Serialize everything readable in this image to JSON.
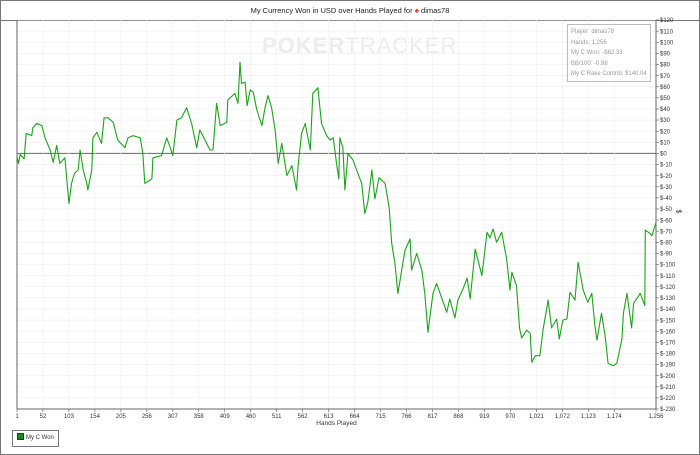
{
  "chart_data": {
    "type": "line",
    "title": "My Currency Won in USD over Hands Played for",
    "player_name": "dimas78",
    "xlabel": "Hands Played",
    "ylabel": "$",
    "xlim": [
      1,
      1256
    ],
    "ylim": [
      -230,
      120
    ],
    "grid": true,
    "x_ticks": [
      "1",
      "52",
      "103",
      "154",
      "205",
      "256",
      "307",
      "358",
      "409",
      "460",
      "511",
      "562",
      "613",
      "664",
      "715",
      "766",
      "817",
      "868",
      "919",
      "970",
      "1,021",
      "1,072",
      "1,123",
      "1,174",
      "1,256"
    ],
    "x_tick_values": [
      1,
      52,
      103,
      154,
      205,
      256,
      307,
      358,
      409,
      460,
      511,
      562,
      613,
      664,
      715,
      766,
      817,
      868,
      919,
      970,
      1021,
      1072,
      1123,
      1174,
      1256
    ],
    "y_ticks": [
      "$120",
      "$110",
      "$100",
      "$90",
      "$80",
      "$70",
      "$60",
      "$50",
      "$40",
      "$30",
      "$20",
      "$10",
      "$0",
      "$-10",
      "$-20",
      "$-30",
      "$-40",
      "$-50",
      "$-60",
      "$-70",
      "$-80",
      "$-90",
      "$-100",
      "$-110",
      "$-120",
      "$-130",
      "$-140",
      "$-150",
      "$-160",
      "$-170",
      "$-180",
      "$-190",
      "$-200",
      "$-210",
      "$-220",
      "$-230"
    ],
    "legend": {
      "position": "bottom-left",
      "entries": [
        "My C Won"
      ]
    },
    "series": [
      {
        "name": "My C Won",
        "color": "#1aa31a",
        "x": [
          1,
          4,
          7,
          15,
          19,
          30,
          32,
          40,
          50,
          56,
          66,
          72,
          79,
          85,
          95,
          103,
          108,
          114,
          121,
          125,
          131,
          138,
          140,
          148,
          150,
          158,
          167,
          172,
          180,
          190,
          199,
          213,
          219,
          229,
          243,
          248,
          252,
          266,
          268,
          285,
          295,
          302,
          307,
          315,
          324,
          334,
          344,
          354,
          360,
          366,
          380,
          386,
          393,
          400,
          413,
          415,
          429,
          435,
          439,
          442,
          449,
          453,
          459,
          465,
          472,
          482,
          488,
          494,
          501,
          508,
          514,
          521,
          531,
          541,
          550,
          553,
          560,
          567,
          577,
          582,
          592,
          599,
          609,
          616,
          622,
          629,
          633,
          635,
          641,
          645,
          651,
          661,
          668,
          678,
          684,
          690,
          698,
          704,
          712,
          724,
          732,
          737,
          743,
          749,
          757,
          763,
          773,
          776,
          786,
          796,
          802,
          808,
          818,
          825,
          838,
          845,
          851,
          861,
          867,
          877,
          885,
          891,
          901,
          914,
          924,
          930,
          936,
          943,
          953,
          963,
          969,
          973,
          982,
          988,
          992,
          1002,
          1009,
          1012,
          1019,
          1028,
          1034,
          1044,
          1051,
          1061,
          1066,
          1073,
          1081,
          1087,
          1097,
          1103,
          1113,
          1122,
          1130,
          1136,
          1140,
          1149,
          1156,
          1162,
          1172,
          1179,
          1189,
          1192,
          1199,
          1208,
          1212,
          1225,
          1234,
          1235,
          1244,
          1248,
          1256
        ],
        "y": [
          -3,
          -9,
          -1,
          -5,
          18,
          16,
          23,
          27,
          25,
          14,
          3,
          -8,
          7,
          -9,
          -4,
          -45,
          -27,
          -18,
          -15,
          3,
          -15,
          -27,
          -33,
          -15,
          14,
          19,
          9,
          32,
          32,
          28,
          12,
          5,
          14,
          16,
          14,
          0,
          -27,
          -23,
          -4,
          -2,
          14,
          5,
          -2,
          30,
          32,
          41,
          27,
          5,
          21,
          16,
          3,
          3,
          45,
          25,
          28,
          48,
          54,
          45,
          82,
          63,
          64,
          43,
          57,
          55,
          39,
          25,
          41,
          52,
          41,
          21,
          -9,
          9,
          -20,
          -11,
          -33,
          -11,
          18,
          27,
          3,
          54,
          59,
          27,
          16,
          12,
          14,
          -11,
          -23,
          14,
          5,
          -33,
          0,
          -6,
          -15,
          -27,
          -54,
          -44,
          -15,
          -41,
          -22,
          -27,
          -49,
          -81,
          -98,
          -126,
          -104,
          -87,
          -77,
          -105,
          -90,
          -105,
          -126,
          -161,
          -126,
          -117,
          -134,
          -143,
          -131,
          -148,
          -132,
          -122,
          -112,
          -131,
          -86,
          -110,
          -71,
          -76,
          -68,
          -80,
          -71,
          -96,
          -123,
          -107,
          -119,
          -157,
          -166,
          -159,
          -162,
          -188,
          -182,
          -182,
          -159,
          -132,
          -157,
          -149,
          -167,
          -150,
          -149,
          -125,
          -132,
          -98,
          -123,
          -134,
          -126,
          -155,
          -168,
          -144,
          -164,
          -189,
          -191,
          -189,
          -167,
          -144,
          -126,
          -157,
          -135,
          -126,
          -137,
          -69,
          -72,
          -74,
          -62.33
        ]
      }
    ]
  },
  "watermark": {
    "bold": "POKER",
    "light": "TRACKER"
  },
  "tooltip": {
    "player": "Player: dimas78",
    "hands": "Hands: 1,256",
    "won": "My C Won: -$62.33",
    "bb100": "BB/100: -0.98",
    "rake": "My C Rake Contrib: $140.04"
  }
}
